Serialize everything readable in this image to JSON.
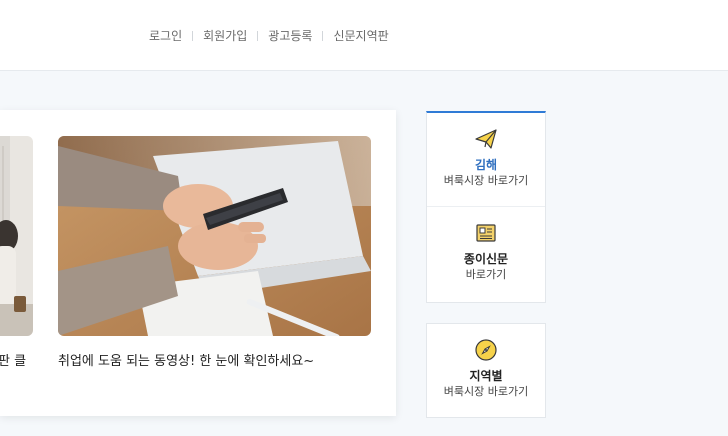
{
  "topnav": {
    "login": "로그인",
    "signup": "회원가입",
    "ad_register": "광고등록",
    "newspaper_region": "신문지역판"
  },
  "panel": {
    "left_caption": "판 클",
    "right_caption": "취업에 도움 되는 동영상! 한 눈에 확인하세요~"
  },
  "sidebar": {
    "gimhae": {
      "title": "김해",
      "subtitle": "벼룩시장 바로가기",
      "icon": "paper-plane-icon"
    },
    "paper": {
      "title": "종이신문",
      "subtitle": "바로가기",
      "icon": "newspaper-icon"
    },
    "region": {
      "title": "지역별",
      "subtitle": "벼룩시장 바로가기",
      "icon": "compass-icon"
    }
  },
  "colors": {
    "accent": "#2f7bd6",
    "background": "#f5f8fb"
  }
}
